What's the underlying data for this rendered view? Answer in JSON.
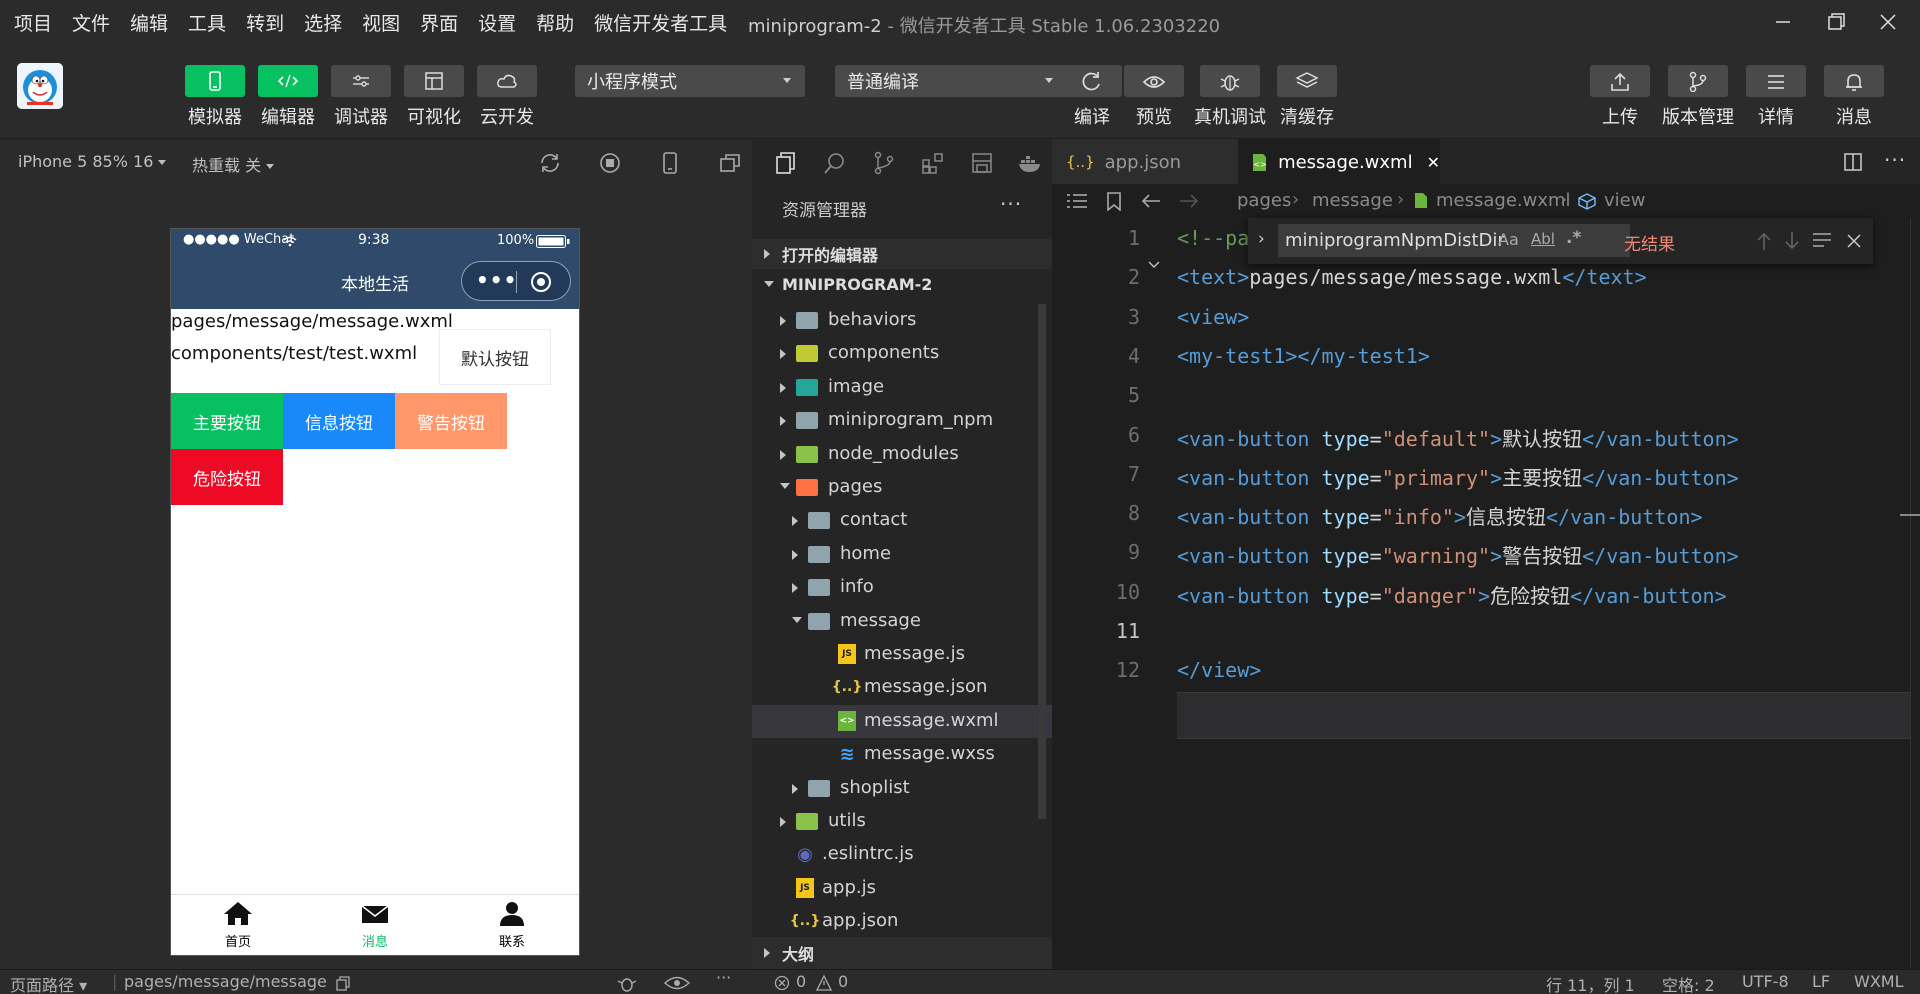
{
  "menu": [
    "项目",
    "文件",
    "编辑",
    "工具",
    "转到",
    "选择",
    "视图",
    "界面",
    "设置",
    "帮助",
    "微信开发者工具"
  ],
  "window": {
    "project": "miniprogram-2",
    "sep": " - ",
    "app": "微信开发者工具 Stable 1.06.2303220"
  },
  "toolbar": {
    "left_tools": [
      {
        "label": "模拟器",
        "icon": "phone-icon",
        "active": true
      },
      {
        "label": "编辑器",
        "icon": "code-icon",
        "active": true
      },
      {
        "label": "调试器",
        "icon": "debug-sliders-icon",
        "active": false
      },
      {
        "label": "可视化",
        "icon": "layout-icon",
        "active": false
      },
      {
        "label": "云开发",
        "icon": "cloud-icon",
        "active": false
      }
    ],
    "mode_select": "小程序模式",
    "compile_select": "普通编译",
    "mid_tools": [
      {
        "label": "编译",
        "icon": "refresh-icon"
      },
      {
        "label": "预览",
        "icon": "eye-icon"
      },
      {
        "label": "真机调试",
        "icon": "bug-icon"
      },
      {
        "label": "清缓存",
        "icon": "layers-icon"
      }
    ],
    "right_tools": [
      {
        "label": "上传",
        "icon": "upload-icon"
      },
      {
        "label": "版本管理",
        "icon": "branch-icon"
      },
      {
        "label": "详情",
        "icon": "menu-lines-icon"
      },
      {
        "label": "消息",
        "icon": "bell-icon"
      }
    ]
  },
  "simulator": {
    "device": "iPhone 5 85% 16",
    "hot_reload": "热重载 关",
    "status": {
      "carrier": "●●●●● WeChat",
      "time": "9:38",
      "battery": "100%"
    },
    "nav_title": "本地生活",
    "capsule_dots": "•••",
    "page_lines": [
      "pages/message/message.wxml",
      "components/test/test.wxml"
    ],
    "buttons": {
      "default": "默认按钮",
      "primary": "主要按钮",
      "info": "信息按钮",
      "warning": "警告按钮",
      "danger": "危险按钮"
    },
    "tabs": [
      {
        "label": "首页",
        "icon": "home-icon",
        "color": "#000000"
      },
      {
        "label": "消息",
        "icon": "mail-icon",
        "color": "#07c160"
      },
      {
        "label": "联系",
        "icon": "user-icon",
        "color": "#000000"
      }
    ]
  },
  "explorer": {
    "title": "资源管理器",
    "more": "···",
    "open_editors": "打开的编辑器",
    "project": "MINIPROGRAM-2",
    "outline": "大纲",
    "tree": [
      {
        "label": "behaviors",
        "type": "folder",
        "depth": 0,
        "open": false
      },
      {
        "label": "components",
        "type": "folder",
        "depth": 0,
        "open": false
      },
      {
        "label": "image",
        "type": "folder",
        "depth": 0,
        "open": false
      },
      {
        "label": "miniprogram_npm",
        "type": "folder",
        "depth": 0,
        "open": false
      },
      {
        "label": "node_modules",
        "type": "folder",
        "depth": 0,
        "open": false
      },
      {
        "label": "pages",
        "type": "folder",
        "depth": 0,
        "open": true
      },
      {
        "label": "contact",
        "type": "folder",
        "depth": 1,
        "open": false
      },
      {
        "label": "home",
        "type": "folder",
        "depth": 1,
        "open": false
      },
      {
        "label": "info",
        "type": "folder",
        "depth": 1,
        "open": false
      },
      {
        "label": "message",
        "type": "folder",
        "depth": 1,
        "open": true
      },
      {
        "label": "message.js",
        "type": "js",
        "depth": 2
      },
      {
        "label": "message.json",
        "type": "json",
        "depth": 2
      },
      {
        "label": "message.wxml",
        "type": "wxml",
        "depth": 2,
        "selected": true
      },
      {
        "label": "message.wxss",
        "type": "wxss",
        "depth": 2
      },
      {
        "label": "shoplist",
        "type": "folder",
        "depth": 1,
        "open": false
      },
      {
        "label": "utils",
        "type": "folder",
        "depth": 0,
        "open": false
      },
      {
        "label": ".eslintrc.js",
        "type": "eslint",
        "depth": 0
      },
      {
        "label": "app.js",
        "type": "js",
        "depth": 0
      },
      {
        "label": "app.json",
        "type": "json",
        "depth": 0
      }
    ]
  },
  "editor": {
    "tabs": [
      {
        "label": "app.json",
        "icon": "{..}",
        "active": false
      },
      {
        "label": "message.wxml",
        "icon": "wxml",
        "active": true,
        "close": "✕"
      }
    ],
    "breadcrumb": [
      "pages",
      "message",
      "message.wxml",
      "view"
    ],
    "find": {
      "query": "miniprogramNpmDistDir",
      "result": "无结果",
      "opt_case": "Aa",
      "opt_word": "Abl",
      "opt_regex": ".*"
    },
    "lines": [
      {
        "n": "1",
        "text": "<!--pa"
      },
      {
        "n": "2",
        "text": "<text>pages/message/message.wxml</text>"
      },
      {
        "n": "3",
        "text": "<view>"
      },
      {
        "n": "4",
        "text": "<my-test1></my-test1>"
      },
      {
        "n": "5",
        "text": ""
      },
      {
        "n": "6",
        "text": "<van-button type=\"default\">默认按钮</van-button>"
      },
      {
        "n": "7",
        "text": "<van-button type=\"primary\">主要按钮</van-button>"
      },
      {
        "n": "8",
        "text": "<van-button type=\"info\">信息按钮</van-button>"
      },
      {
        "n": "9",
        "text": "<van-button type=\"warning\">警告按钮</van-button>"
      },
      {
        "n": "10",
        "text": "<van-button type=\"danger\">危险按钮</van-button>"
      },
      {
        "n": "11",
        "text": ""
      },
      {
        "n": "12",
        "text": "</view>"
      }
    ]
  },
  "statusbar": {
    "page_path_label": "页面路径",
    "page_path": "pages/message/message",
    "errors": "0",
    "warnings": "0",
    "position": "行 11，列 1",
    "spaces": "空格: 2",
    "encoding": "UTF-8",
    "eol": "LF",
    "lang": "WXML"
  },
  "colors": {
    "green": "#07c160",
    "blue": "#1989fa",
    "orange": "#ff976a",
    "red": "#ee0a24",
    "navbar": "#2f4a6b"
  }
}
